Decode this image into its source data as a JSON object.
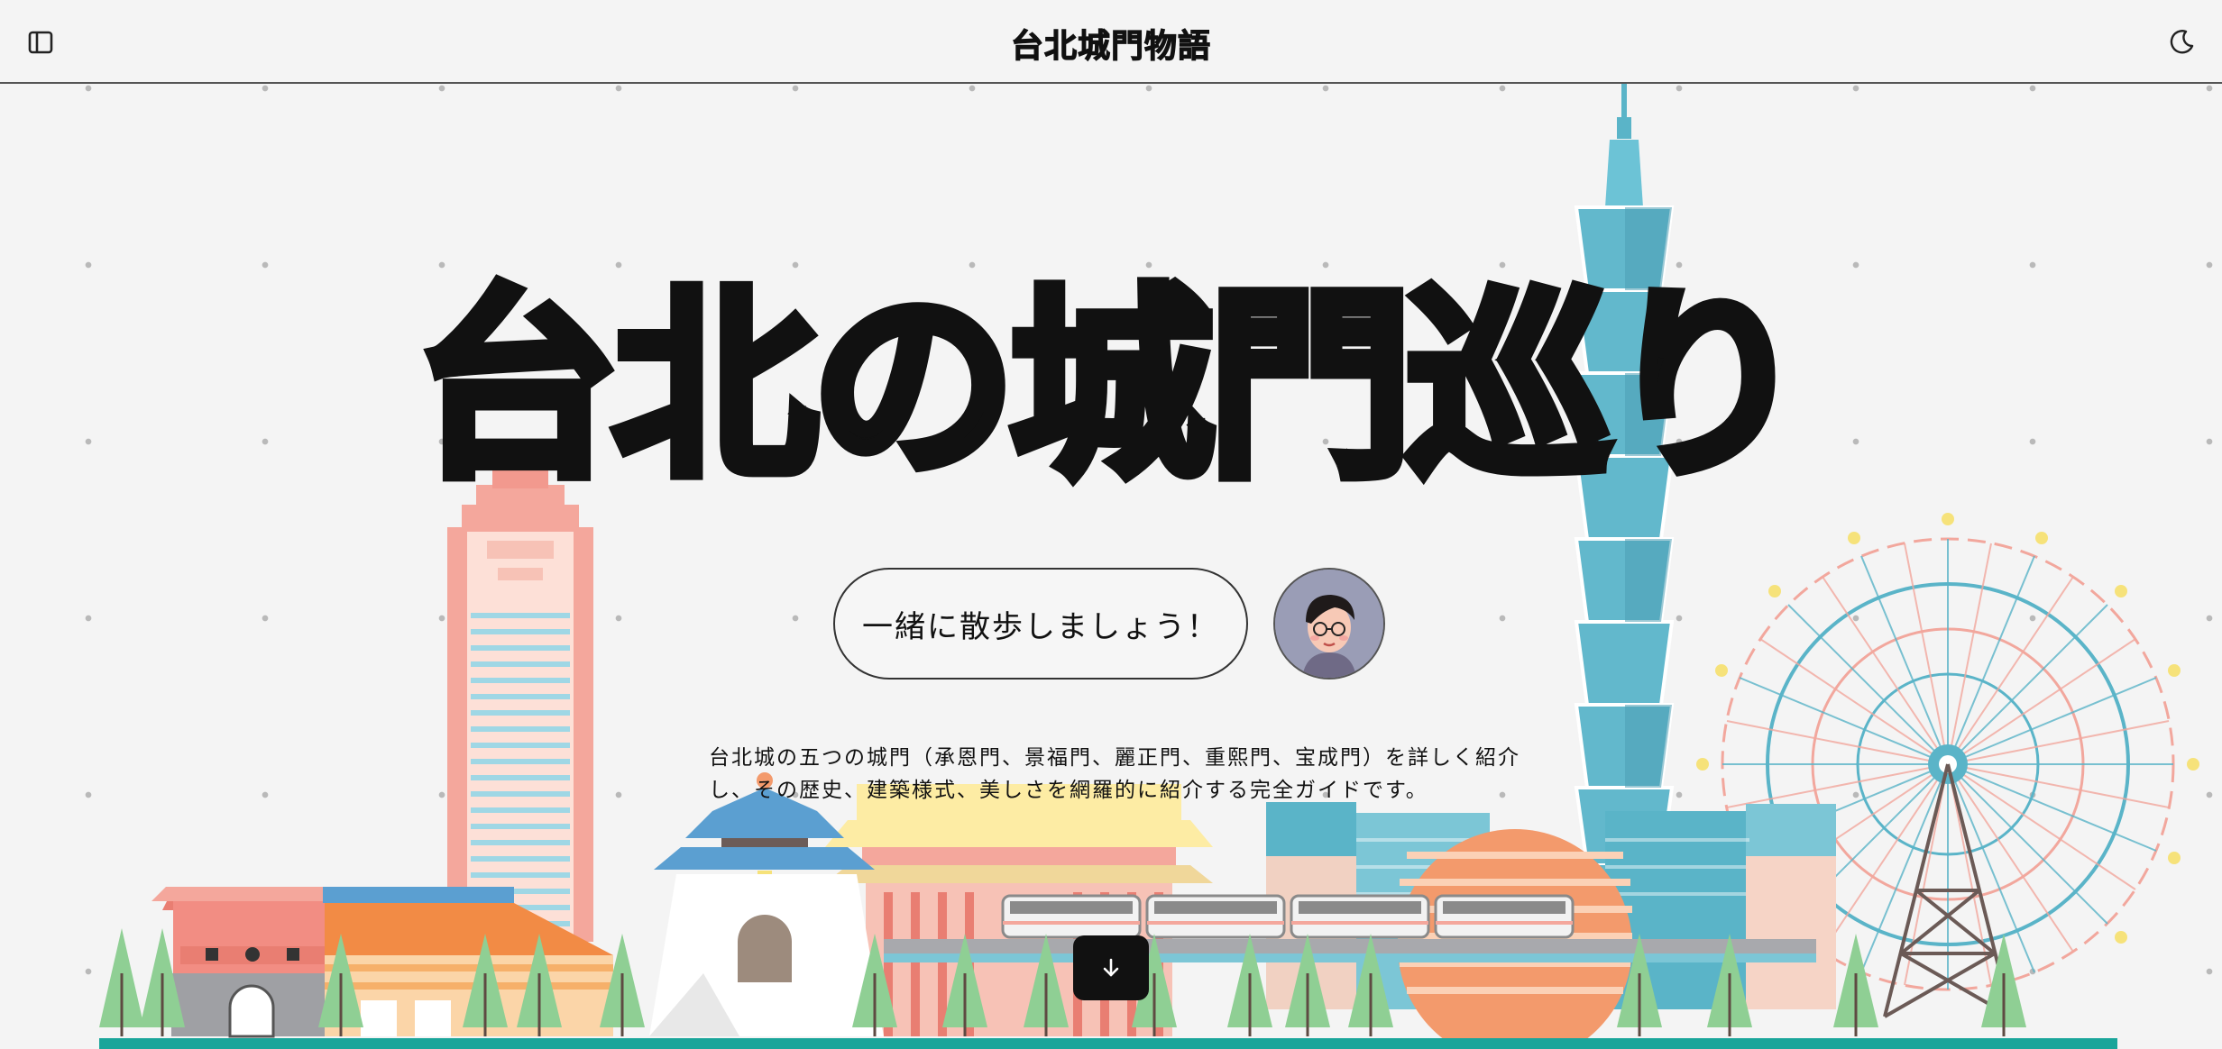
{
  "header": {
    "site_title": "台北城門物語"
  },
  "hero": {
    "title": "台北の城門巡り",
    "cta_label": "一緒に散歩しましょう！",
    "description": "台北城の五つの城門（承恩門、景福門、麗正門、重熙門、宝成門）を詳しく紹介し、その歴史、建築様式、美しさを網羅的に紹介する完全ガイドです。"
  },
  "icons": {
    "sidebar": "sidebar-panel-icon",
    "theme": "moon-icon",
    "scroll": "arrow-down-icon",
    "avatar": "cartoon-man-avatar"
  },
  "colors": {
    "background": "#f4f4f4",
    "text": "#111111",
    "ground": "#1aa59a",
    "tower": "#5ab4c8",
    "skyscraper": "#f2a79d"
  }
}
